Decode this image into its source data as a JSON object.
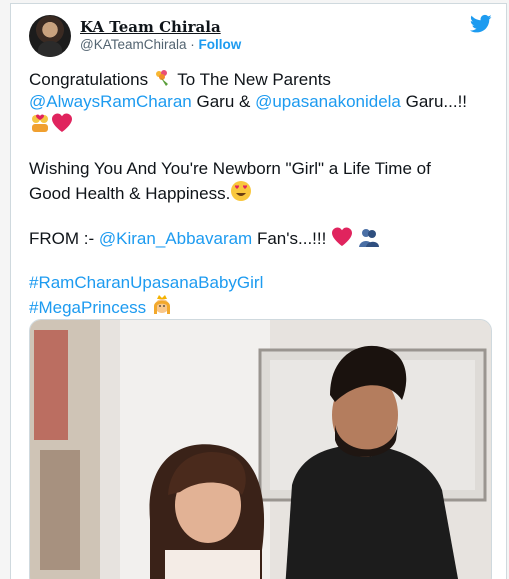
{
  "tweet": {
    "display_name": "KA Team Chirala",
    "handle": "@KATeamChirala",
    "separator": "·",
    "follow_label": "Follow",
    "lines": {
      "l1_text": "Congratulations ",
      "l1_text2": " To The New Parents",
      "l2_mention1": "@AlwaysRamCharan",
      "l2_mid": " Garu & ",
      "l2_mention2": "@upasanakonidela",
      "l2_end": " Garu...!!",
      "l4": "Wishing You And You're Newborn \"Girl\" a Life Time of",
      "l5": "Good Health & Happiness.",
      "l6_from": "FROM :- ",
      "l6_mention": "@Kiran_Abbavaram",
      "l6_end": " Fan's...!!! ",
      "hashtag1": "#RamCharanUpasanaBabyGirl",
      "hashtag2": "#MegaPrincess"
    }
  },
  "icons": {
    "brand": "twitter-bird-icon",
    "bouquet": "bouquet-emoji",
    "couple": "couple-with-heart-emoji",
    "heart": "red-heart-emoji",
    "heart_eyes": "smiling-face-heart-eyes-emoji",
    "hugging": "people-hugging-emoji",
    "princess": "princess-emoji"
  },
  "colors": {
    "link": "#1d9bf0",
    "text": "#0f1419",
    "muted": "#536471",
    "heart": "#e0245e"
  }
}
